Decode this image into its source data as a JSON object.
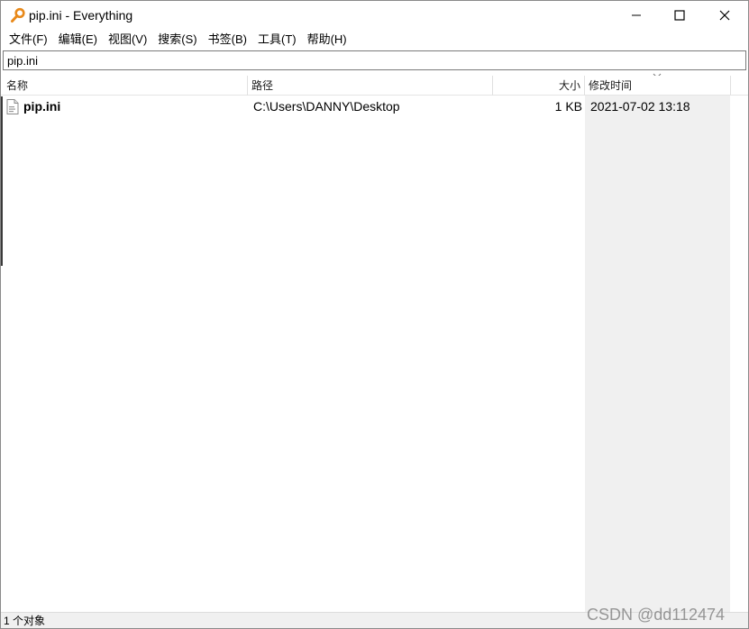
{
  "window": {
    "title": "pip.ini - Everything",
    "icon": "magnifier-key-icon"
  },
  "menu": {
    "items": [
      "文件(F)",
      "编辑(E)",
      "视图(V)",
      "搜索(S)",
      "书签(B)",
      "工具(T)",
      "帮助(H)"
    ]
  },
  "search": {
    "value": "pip.ini"
  },
  "columns": {
    "name": "名称",
    "path": "路径",
    "size": "大小",
    "modified": "修改时间"
  },
  "results": [
    {
      "name": "pip.ini",
      "path": "C:\\Users\\DANNY\\Desktop",
      "size": "1 KB",
      "modified": "2021-07-02 13:18",
      "icon": "ini-file-icon"
    }
  ],
  "status": {
    "text": "1 个对象"
  },
  "watermark": "CSDN @dd112474",
  "colors": {
    "icon_orange": "#e8891a",
    "sorted_column_bg": "#f0f0f0"
  }
}
